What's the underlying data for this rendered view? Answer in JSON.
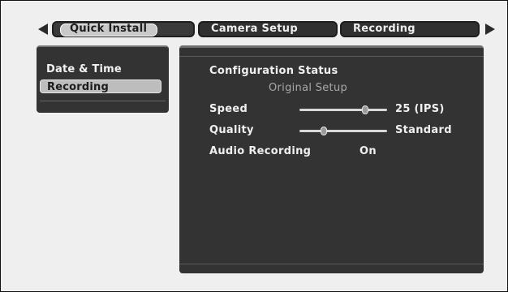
{
  "tabs": [
    {
      "label": "Quick Install",
      "selected": true
    },
    {
      "label": "Camera Setup",
      "selected": false
    },
    {
      "label": "Recording",
      "selected": false
    }
  ],
  "menu": {
    "items": [
      {
        "label": "Date & Time",
        "selected": false
      },
      {
        "label": "Recording",
        "selected": true
      }
    ]
  },
  "panel": {
    "title": "Configuration Status",
    "subtitle": "Original Setup",
    "speed": {
      "label": "Speed",
      "value": "25 (IPS)",
      "slider_level": 0.75
    },
    "quality": {
      "label": "Quality",
      "value": "Standard",
      "slider_level": 0.28
    },
    "audio": {
      "label": "Audio Recording",
      "value": "On"
    }
  },
  "icons": [
    "arrow-left-icon",
    "arrow-right-icon"
  ]
}
